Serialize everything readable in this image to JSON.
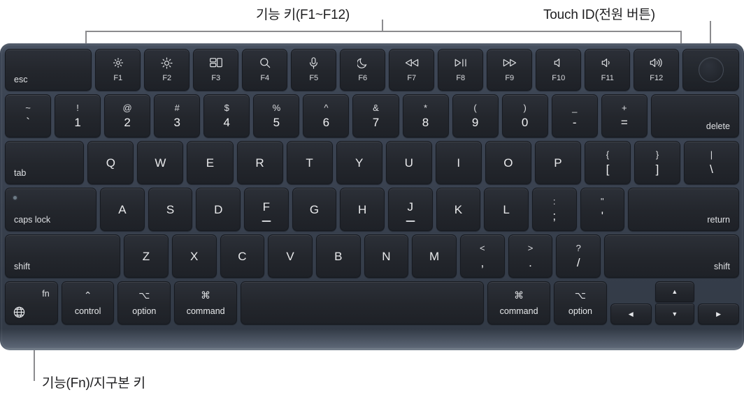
{
  "annotations": {
    "function_keys": "기능 키(F1~F12)",
    "touch_id": "Touch ID(전원 버튼)",
    "fn_key": "기능(Fn)/지구본 키"
  },
  "colors": {
    "chassis": "#39414f",
    "keycap": "#23262c",
    "legend": "#e8e9eb",
    "leader_line": "#8b8b8e",
    "annotation_text": "#1d1d1f"
  },
  "keyboard": {
    "layout": "Apple Magic Keyboard with Touch ID (US ANSI)",
    "rows": {
      "function": [
        {
          "label": "esc",
          "icon": ""
        },
        {
          "label": "F1",
          "icon": "brightness-down-icon"
        },
        {
          "label": "F2",
          "icon": "brightness-up-icon"
        },
        {
          "label": "F3",
          "icon": "mission-control-icon"
        },
        {
          "label": "F4",
          "icon": "spotlight-search-icon"
        },
        {
          "label": "F5",
          "icon": "dictation-microphone-icon"
        },
        {
          "label": "F6",
          "icon": "do-not-disturb-moon-icon"
        },
        {
          "label": "F7",
          "icon": "media-rewind-icon"
        },
        {
          "label": "F8",
          "icon": "media-play-pause-icon"
        },
        {
          "label": "F9",
          "icon": "media-fast-forward-icon"
        },
        {
          "label": "F10",
          "icon": "volume-mute-icon"
        },
        {
          "label": "F11",
          "icon": "volume-down-icon"
        },
        {
          "label": "F12",
          "icon": "volume-up-icon"
        },
        {
          "label": "",
          "icon": "touch-id-icon"
        }
      ],
      "numbers": [
        {
          "top": "~",
          "bottom": "`"
        },
        {
          "top": "!",
          "bottom": "1"
        },
        {
          "top": "@",
          "bottom": "2"
        },
        {
          "top": "#",
          "bottom": "3"
        },
        {
          "top": "$",
          "bottom": "4"
        },
        {
          "top": "%",
          "bottom": "5"
        },
        {
          "top": "^",
          "bottom": "6"
        },
        {
          "top": "&",
          "bottom": "7"
        },
        {
          "top": "*",
          "bottom": "8"
        },
        {
          "top": "(",
          "bottom": "9"
        },
        {
          "top": ")",
          "bottom": "0"
        },
        {
          "top": "_",
          "bottom": "-"
        },
        {
          "top": "+",
          "bottom": "="
        },
        {
          "top": "",
          "bottom": "delete"
        }
      ],
      "qwerty": [
        "tab",
        "Q",
        "W",
        "E",
        "R",
        "T",
        "Y",
        "U",
        "I",
        "O",
        "P",
        {
          "top": "{",
          "bottom": "["
        },
        {
          "top": "}",
          "bottom": "]"
        },
        {
          "top": "|",
          "bottom": "\\"
        }
      ],
      "home": [
        "caps lock",
        "A",
        "S",
        "D",
        "F",
        "G",
        "H",
        "J",
        "K",
        "L",
        {
          "top": ":",
          "bottom": ";"
        },
        {
          "top": "\"",
          "bottom": "'"
        },
        "return"
      ],
      "shift": [
        "shift",
        "Z",
        "X",
        "C",
        "V",
        "B",
        "N",
        "M",
        {
          "top": "<",
          "bottom": ","
        },
        {
          "top": ">",
          "bottom": "."
        },
        {
          "top": "?",
          "bottom": "/"
        },
        "shift"
      ],
      "bottom": [
        {
          "sym": "fn",
          "word": "",
          "icon": "globe-icon"
        },
        {
          "sym": "⌃",
          "word": "control"
        },
        {
          "sym": "⌥",
          "word": "option"
        },
        {
          "sym": "⌘",
          "word": "command"
        },
        {
          "sym": "",
          "word": "",
          "icon": "space-bar"
        },
        {
          "sym": "⌘",
          "word": "command"
        },
        {
          "sym": "⌥",
          "word": "option"
        },
        {
          "sym": "◀",
          "word": "",
          "icon": "arrow-left-icon"
        },
        {
          "sym": "▲",
          "word": "",
          "icon": "arrow-up-icon"
        },
        {
          "sym": "▼",
          "word": "",
          "icon": "arrow-down-icon"
        },
        {
          "sym": "▶",
          "word": "",
          "icon": "arrow-right-icon"
        }
      ]
    }
  }
}
